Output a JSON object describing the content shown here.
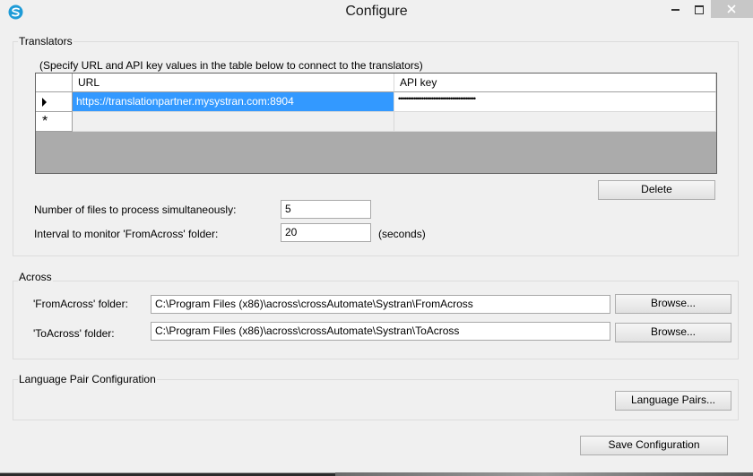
{
  "window": {
    "title": "Configure"
  },
  "translators": {
    "group_label": "Translators",
    "instruction": "(Specify URL and API key values in the table below to connect to the translators)",
    "columns": {
      "url": "URL",
      "api_key": "API key"
    },
    "rows": [
      {
        "url": "https://translationpartner.mysystran.com:8904",
        "api_key": "••••••••••••••••••••••••••••••••••••••••"
      }
    ],
    "new_row_marker": "*",
    "delete_label": "Delete",
    "files_label": "Number of files to process simultaneously:",
    "files_value": "5",
    "interval_label": "Interval to monitor 'FromAcross' folder:",
    "interval_value": "20",
    "interval_unit": "(seconds)"
  },
  "across": {
    "group_label": "Across",
    "from_label": "'FromAcross' folder:",
    "from_value": "C:\\Program Files (x86)\\across\\crossAutomate\\Systran\\FromAcross",
    "to_label": "'ToAcross' folder:",
    "to_value": "C:\\Program Files (x86)\\across\\crossAutomate\\Systran\\ToAcross",
    "browse_label": "Browse..."
  },
  "language": {
    "group_label": "Language Pair Configuration",
    "button_label": "Language Pairs..."
  },
  "save_label": "Save Configuration",
  "colors": {
    "selection": "#3399ff",
    "close_hover": "#c7c7c7",
    "app_icon": "#1e9bd7"
  }
}
